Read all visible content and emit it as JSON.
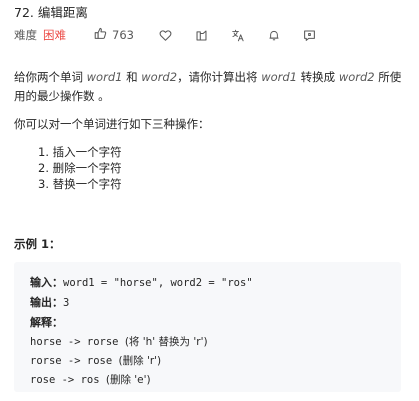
{
  "problem": {
    "title": "72. 编辑距离",
    "difficulty_label": "难度",
    "difficulty_value": "困难",
    "likes": "763",
    "difficulty_color": "#ec4c47"
  },
  "toolbar_icons": [
    "thumbs-up-icon",
    "heart-icon",
    "share-icon",
    "translate-icon",
    "bell-icon",
    "comment-icon"
  ],
  "description": {
    "p1_prefix": "给你两个单词 ",
    "word1": "word1",
    "p1_mid1": " 和 ",
    "word2": "word2",
    "p1_mid2": "，请你计算出将 ",
    "word1b": "word1",
    "p1_mid3": " 转换成 ",
    "word2b": "word2",
    "p1_suffix": " 所使用的最少操作数 。",
    "p2": "你可以对一个单词进行如下三种操作：",
    "operations": [
      "1. 插入一个字符",
      "2. 删除一个字符",
      "3. 替换一个字符"
    ]
  },
  "example": {
    "title": "示例 1：",
    "input_label": "输入：",
    "input_value": "word1 = \"horse\", word2 = \"ros\"",
    "output_label": "输出：",
    "output_value": "3",
    "explain_label": "解释：",
    "steps": [
      {
        "code": "horse -> rorse ",
        "note": "(将 'h' 替换为 'r')"
      },
      {
        "code": "rorse -> rose ",
        "note": "(删除 'r')"
      },
      {
        "code": "rose -> ros ",
        "note": "(删除 'e')"
      }
    ]
  }
}
